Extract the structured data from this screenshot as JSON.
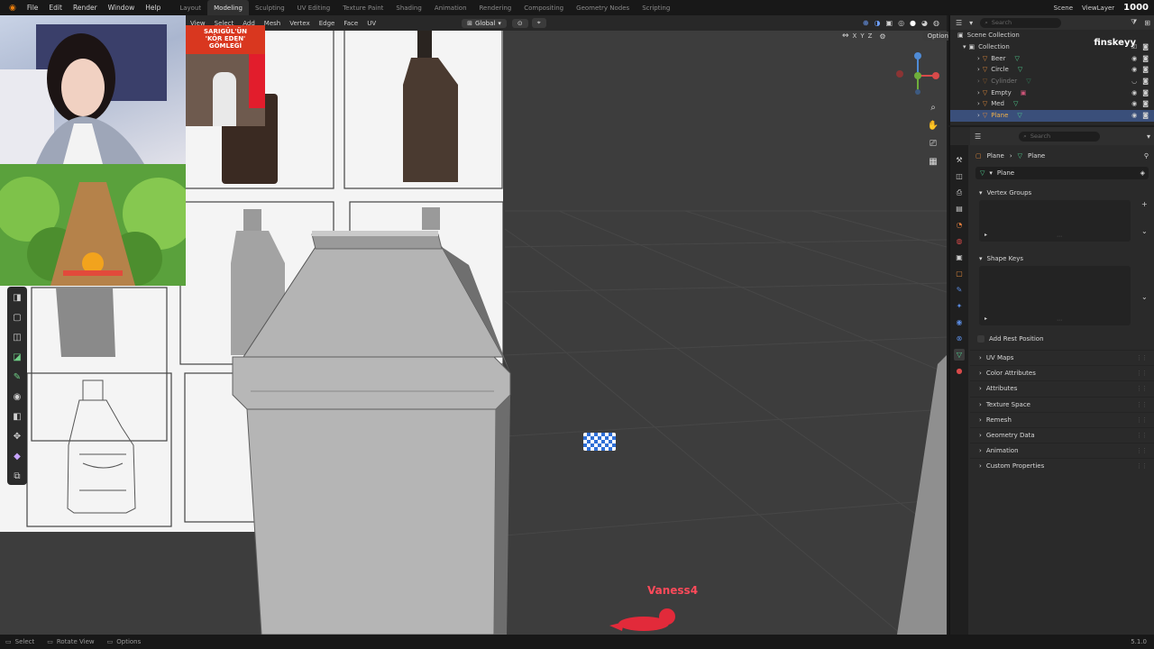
{
  "menu": [
    "File",
    "Edit",
    "Render",
    "Window",
    "Help"
  ],
  "workspaces": [
    "Layout",
    "Modeling",
    "Sculpting",
    "UV Editing",
    "Texture Paint",
    "Shading",
    "Animation",
    "Rendering",
    "Compositing",
    "Geometry Nodes",
    "Scripting"
  ],
  "active_workspace": "Modeling",
  "top_right": {
    "scene": "Scene",
    "view_layer": "ViewLayer",
    "watermark_count": "1000"
  },
  "viewport_header": {
    "mode": "Edit Mode",
    "menus": [
      "View",
      "Select",
      "Add",
      "Mesh",
      "Vertex",
      "Edge",
      "Face",
      "UV"
    ],
    "transform_orientation": "Global",
    "axes": [
      "X",
      "Y",
      "Z"
    ],
    "options": "Options"
  },
  "overlays": {
    "news_caption": [
      "SARIGÜL'ÜN",
      "'KÖR EDEN'",
      "GÖMLEĞİ"
    ],
    "streamer_name": "Vaness4",
    "watermark": "finskeyy"
  },
  "outliner": {
    "root": "Scene Collection",
    "collection": "Collection",
    "search_placeholder": "Search",
    "items": [
      {
        "name": "Beer",
        "selected": false,
        "dim": false
      },
      {
        "name": "Circle",
        "selected": false,
        "dim": false
      },
      {
        "name": "Cylinder",
        "selected": false,
        "dim": true
      },
      {
        "name": "Empty",
        "selected": false,
        "dim": false
      },
      {
        "name": "Med",
        "selected": false,
        "dim": false
      },
      {
        "name": "Plane",
        "selected": true,
        "dim": false
      }
    ]
  },
  "properties": {
    "search_placeholder": "Search",
    "breadcrumb": [
      "Plane",
      "Plane"
    ],
    "mesh_name": "Plane",
    "vertex_groups": "Vertex Groups",
    "shape_keys": "Shape Keys",
    "add_rest_position": "Add Rest Position",
    "sections": [
      "UV Maps",
      "Color Attributes",
      "Attributes",
      "Texture Space",
      "Remesh",
      "Geometry Data",
      "Animation",
      "Custom Properties"
    ]
  },
  "status": {
    "select": "Select",
    "rotate": "Rotate View",
    "options": "Options",
    "version": "5.1.0"
  }
}
